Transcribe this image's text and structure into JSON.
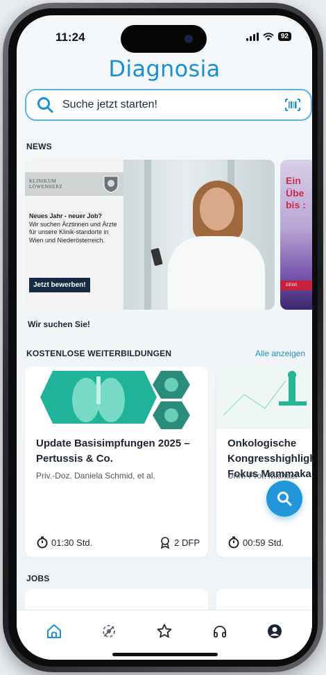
{
  "status": {
    "time": "11:24",
    "battery": "92"
  },
  "app": {
    "title": "Diagnosia"
  },
  "search": {
    "placeholder": "Suche jetzt starten!"
  },
  "news": {
    "section_title": "NEWS",
    "caption": "Wir suchen Sie!",
    "banner": {
      "logo_line1": "KLINIKUM",
      "logo_line2": "LÖWENHERZ",
      "headline": "Neues Jahr - neuer Job?",
      "body": "Wir suchen Ärztinnen und Ärzte für unsere Klinik-standorte in Wien und Niederösterreich.",
      "cta": "Jetzt bewerben!"
    },
    "banner2": {
      "line1": "Ein",
      "line2": "Übe",
      "line3": "bis :",
      "strip": "GEWI"
    }
  },
  "courses": {
    "section_title": "KOSTENLOSE WEITERBILDUNGEN",
    "show_all": "Alle anzeigen",
    "items": [
      {
        "title": "Update Basisimpfungen 2025 – Pertussis & Co.",
        "author": "Priv.-Doz. Daniela Schmid, et al.",
        "duration": "01:30 Std.",
        "points": "2 DFP"
      },
      {
        "title": "Onkologische Kongresshighligh Fokus Mammaka",
        "author": "Univ.-Prof. Michael",
        "duration": "00:59 Std."
      }
    ]
  },
  "jobs": {
    "section_title": "JOBS"
  },
  "tabs": [
    "home-icon",
    "virus-icon",
    "star-icon",
    "headphones-icon",
    "user-icon"
  ],
  "colors": {
    "accent": "#1a8fd6",
    "fab": "#2196d8",
    "button_dark": "#172a44"
  }
}
